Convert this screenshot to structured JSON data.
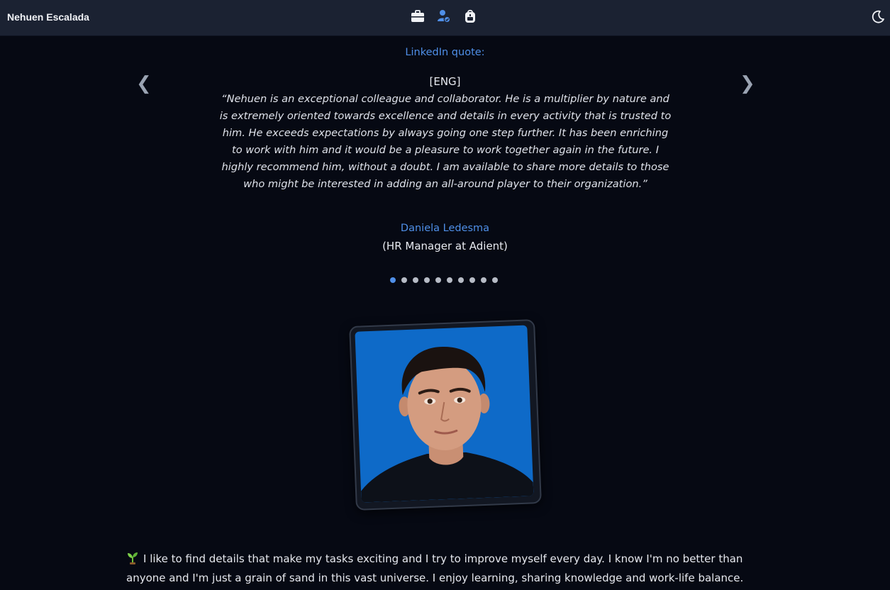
{
  "header": {
    "brand": "Nehuen Escalada",
    "icons": [
      "briefcase-icon",
      "user-check-icon",
      "backpack-icon"
    ],
    "theme_icon": "moon-icon"
  },
  "testimonial": {
    "heading": "LinkedIn quote:",
    "language": "[ENG]",
    "quote": "“Nehuen is an exceptional colleague and collaborator. He is a multiplier by nature and is extremely oriented towards excellence and details in every activity that is trusted to him. He exceeds expectations by always going one step further. It has been enriching to work with him and it would be a pleasure to work together again in the future. I highly recommend him, without a doubt. I am available to share more details to those who might be interested in adding an all-around player to their organization.”",
    "author": "Daniela Ledesma",
    "role": "(HR Manager at Adient)",
    "prev_arrow": "❮",
    "next_arrow": "❯",
    "dots_total": 10,
    "active_dot": 0
  },
  "bio": {
    "icon": "sprout-emoji",
    "text": "I like to find details that make my tasks exciting and I try to improve myself every day. I know I'm no better than anyone and I'm just a grain of sand in this vast universe. I enjoy learning, sharing knowledge and work-life balance."
  },
  "colors": {
    "accent": "#4f8fe8",
    "background": "#060913",
    "header": "#1b2232",
    "photo_background": "#0e6ac8"
  }
}
